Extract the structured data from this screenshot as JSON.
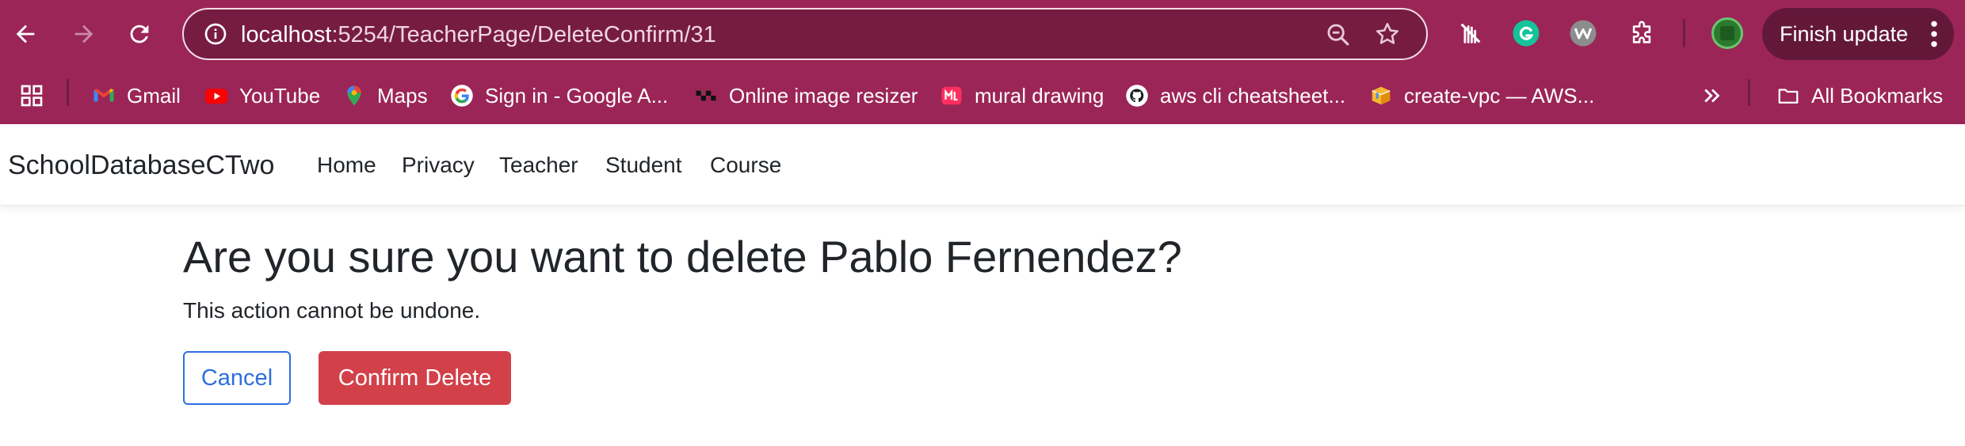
{
  "browser": {
    "url_host": "localhost",
    "url_path": ":5254/TeacherPage/DeleteConfirm/31",
    "finish_update_label": "Finish update",
    "bookmarks": [
      {
        "label": "Gmail",
        "icon": "gmail-icon"
      },
      {
        "label": "YouTube",
        "icon": "youtube-icon"
      },
      {
        "label": "Maps",
        "icon": "maps-icon"
      },
      {
        "label": "Sign in - Google A...",
        "icon": "google-icon"
      },
      {
        "label": "Online image resizer",
        "icon": "resizer-icon"
      },
      {
        "label": "mural drawing",
        "icon": "mural-icon"
      },
      {
        "label": "aws cli cheatsheet...",
        "icon": "github-icon"
      },
      {
        "label": "create-vpc — AWS...",
        "icon": "aws-box-icon"
      }
    ],
    "all_bookmarks_label": "All Bookmarks",
    "colors": {
      "chrome": "#9b2557",
      "omnibox": "#761c42"
    }
  },
  "site": {
    "brand": "SchoolDatabaseCTwo",
    "nav": [
      "Home",
      "Privacy",
      "Teacher",
      "Student",
      "Course"
    ]
  },
  "page": {
    "heading": "Are you sure you want to delete Pablo Fernendez?",
    "subtext": "This action cannot be undone.",
    "cancel_label": "Cancel",
    "confirm_label": "Confirm Delete",
    "colors": {
      "primary": "#2d6fe0",
      "danger": "#d2414a"
    }
  }
}
